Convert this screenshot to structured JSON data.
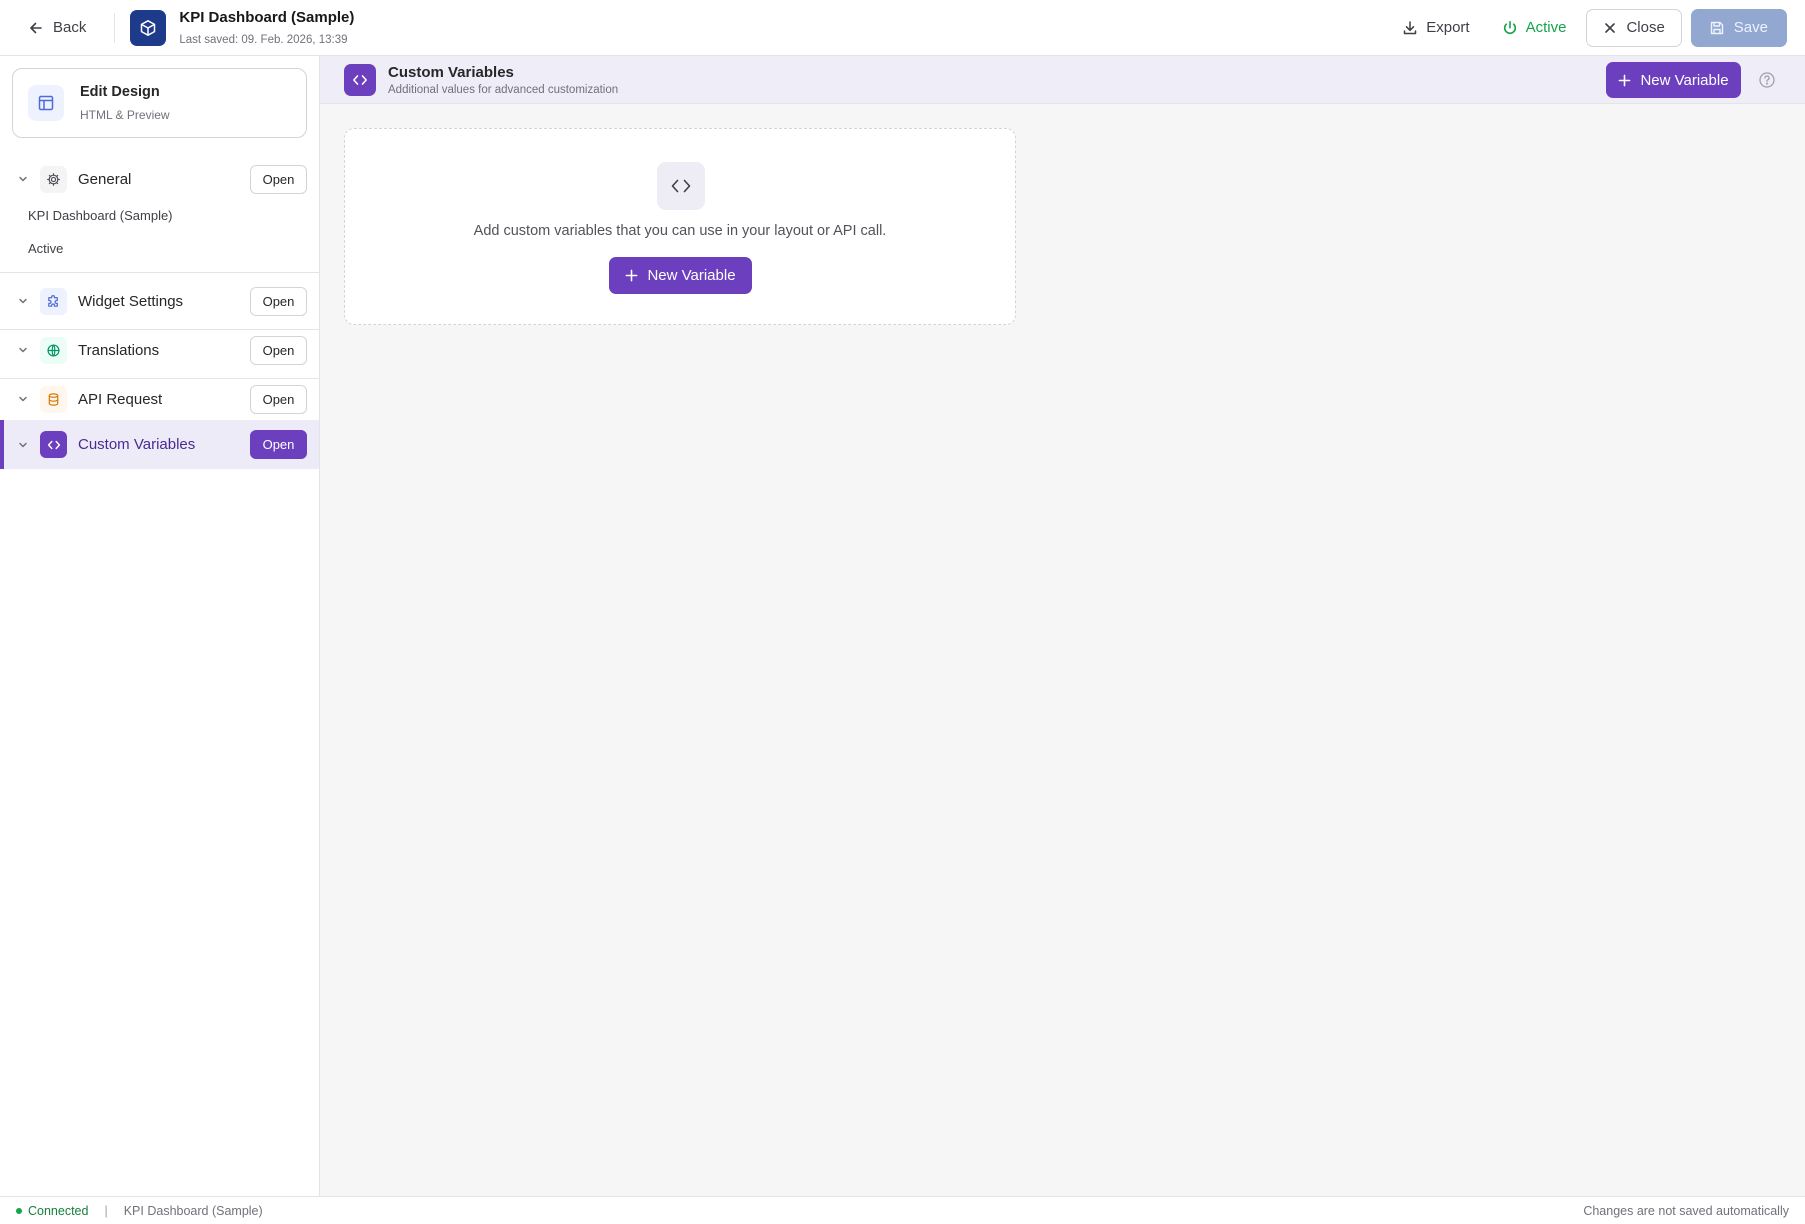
{
  "topbar": {
    "back_label": "Back",
    "app_title": "KPI Dashboard (Sample)",
    "last_saved": "Last saved: 09. Feb. 2026, 13:39",
    "export_label": "Export",
    "active_label": "Active",
    "close_label": "Close",
    "save_label": "Save"
  },
  "sidebar": {
    "edit_design": {
      "title": "Edit Design",
      "subtitle": "HTML & Preview"
    },
    "sections": [
      {
        "label": "General",
        "open_label": "Open",
        "icon": "gear-icon"
      },
      {
        "label": "Widget Settings",
        "open_label": "Open",
        "icon": "puzzle-icon"
      },
      {
        "label": "Translations",
        "open_label": "Open",
        "icon": "globe-icon"
      },
      {
        "label": "API Request",
        "open_label": "Open",
        "icon": "database-icon"
      },
      {
        "label": "Custom Variables",
        "open_label": "Open",
        "icon": "code-icon",
        "selected": true
      }
    ],
    "general_items": [
      "KPI Dashboard (Sample)",
      "Active"
    ]
  },
  "main": {
    "title": "Custom Variables",
    "subtitle": "Additional values for advanced customization",
    "new_variable_label": "New Variable",
    "empty_state": {
      "text": "Add custom variables that you can use in your layout or API call.",
      "button_label": "New Variable"
    }
  },
  "statusbar": {
    "connection": "Connected",
    "separator": "|",
    "widget_name": "KPI Dashboard (Sample)",
    "note": "Changes are not saved automatically"
  },
  "colors": {
    "accent": "#6b3fbd",
    "brand_icon_bg": "#1e3a8a",
    "active_green": "#16a34a",
    "save_disabled": "#93a8d0"
  }
}
